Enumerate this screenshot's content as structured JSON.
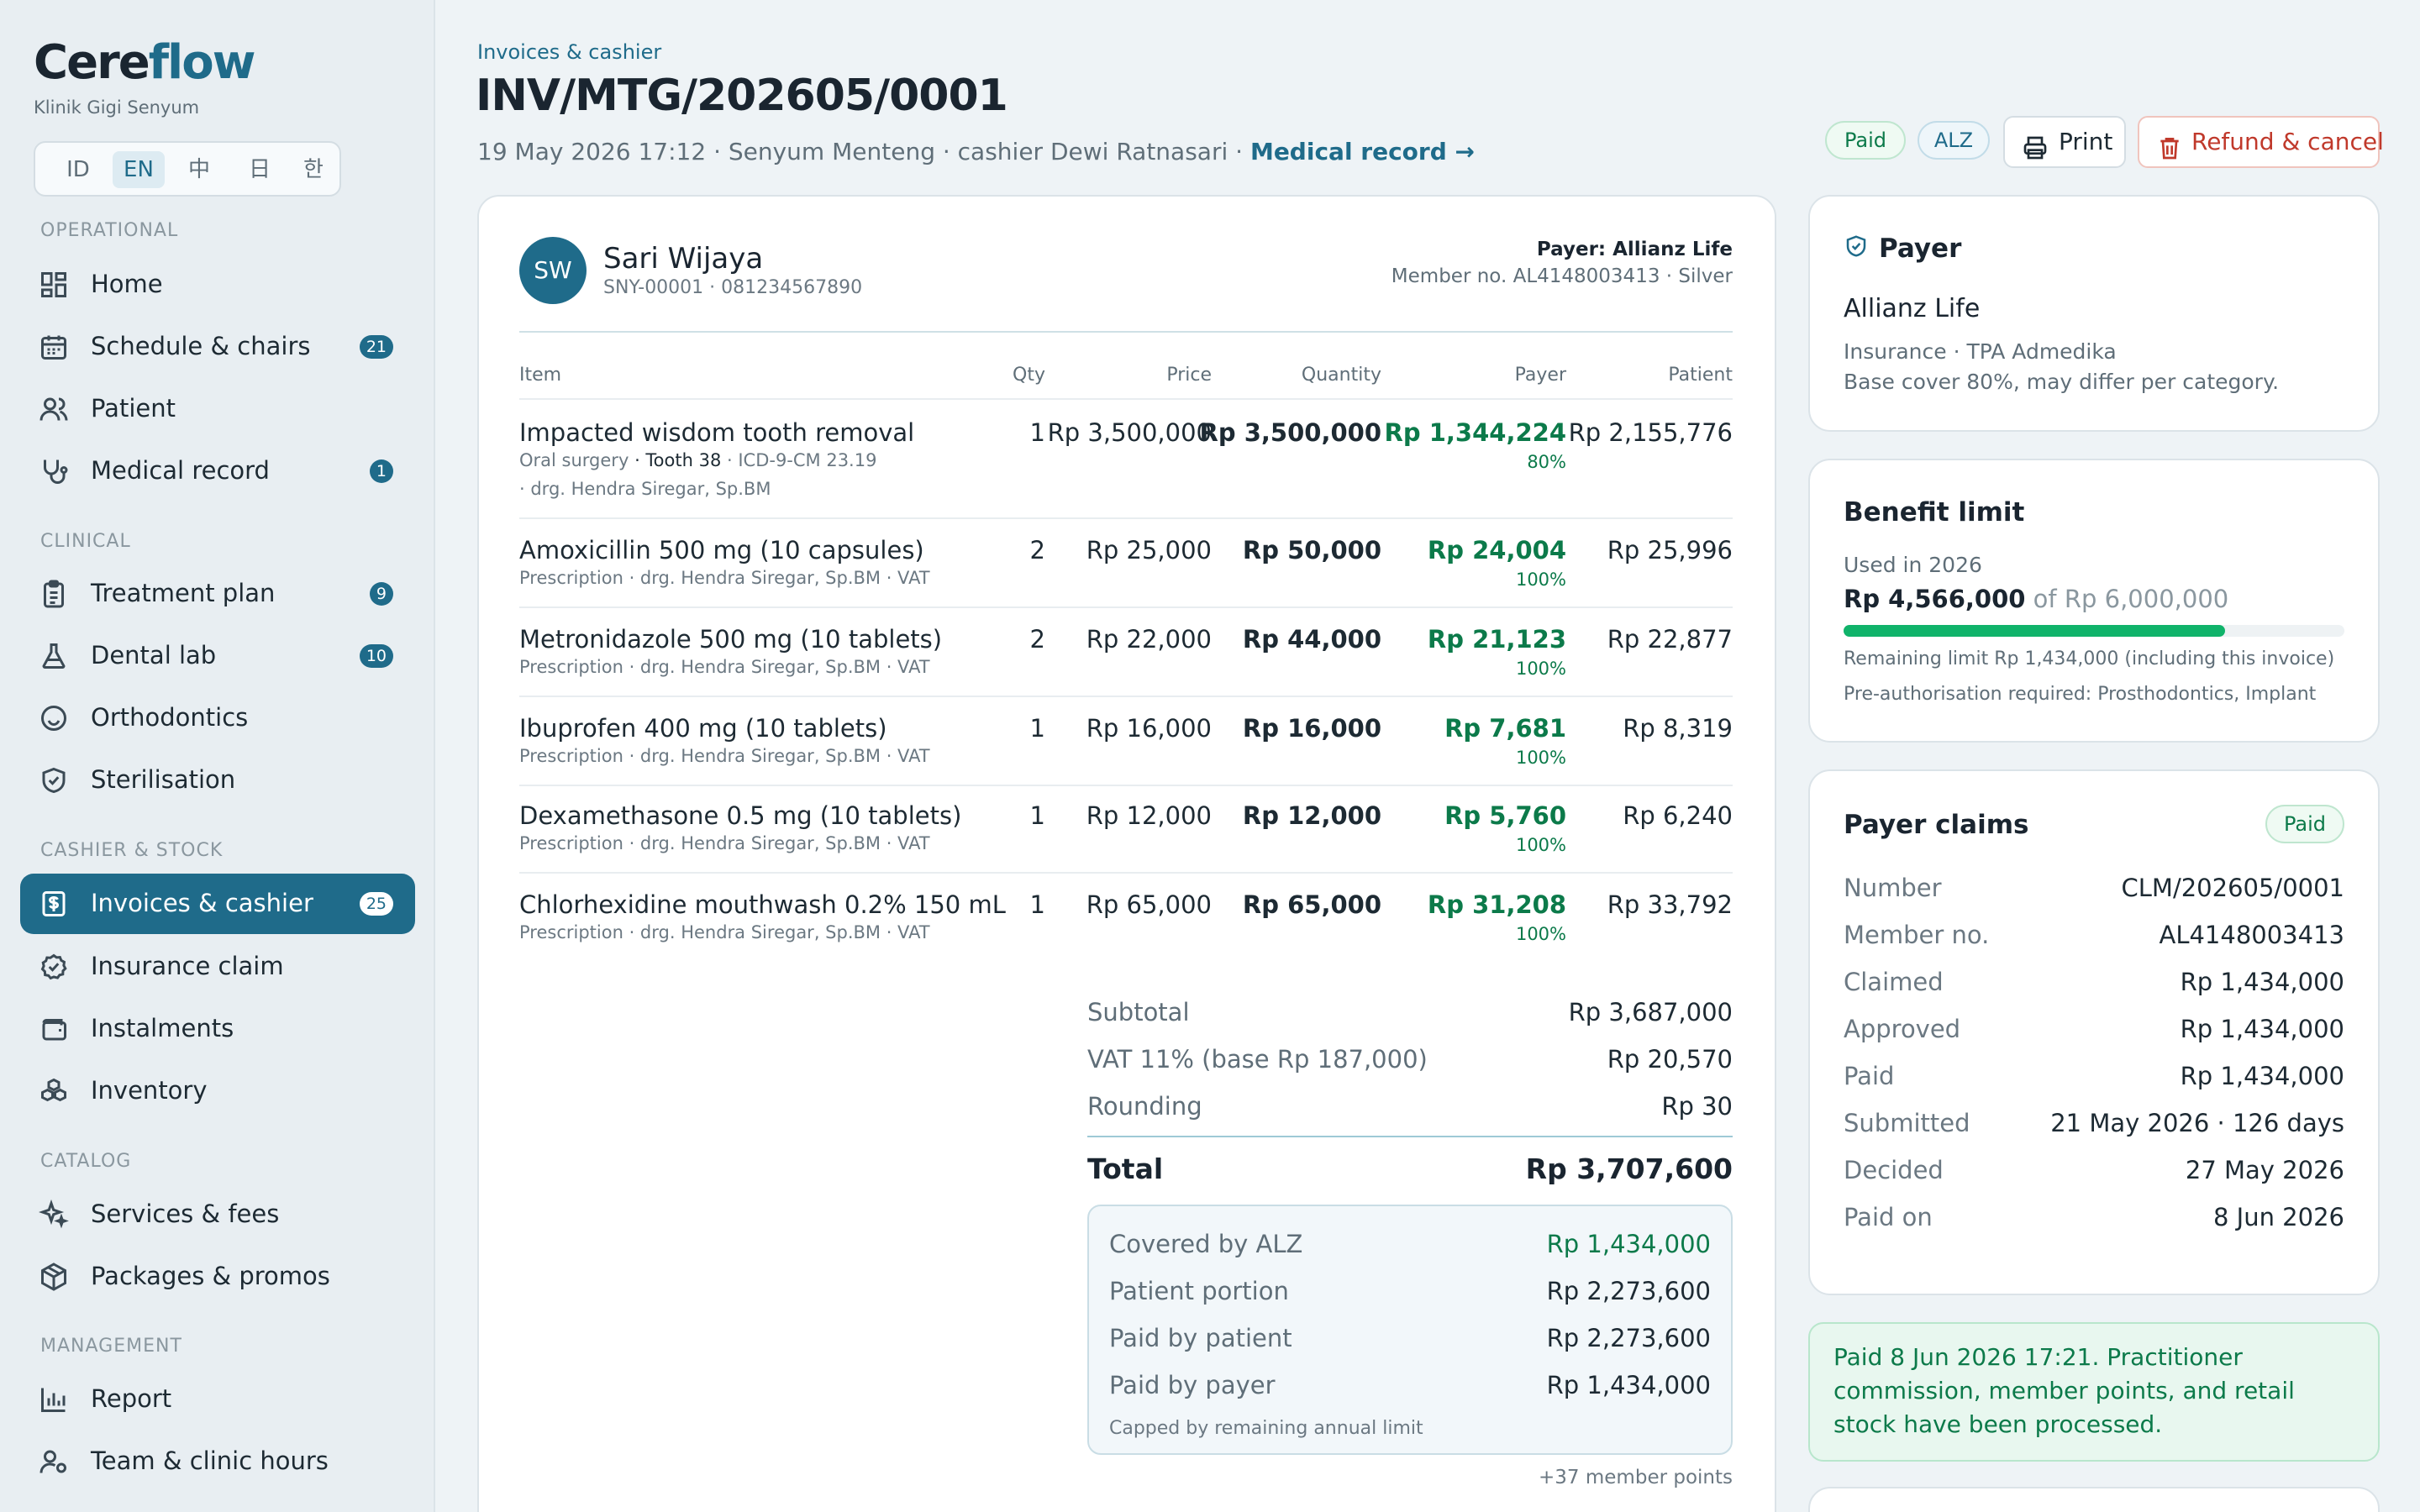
{
  "app": {
    "brand_part1": "Cere",
    "brand_part2": "flow",
    "clinic": "Klinik Gigi Senyum"
  },
  "languages": [
    "ID",
    "EN",
    "中",
    "日",
    "한"
  ],
  "active_language": "EN",
  "nav_sections": {
    "operational": "OPERATIONAL",
    "clinical": "CLINICAL",
    "cashier_stock": "CASHIER & STOCK",
    "catalog": "CATALOG",
    "management": "MANAGEMENT"
  },
  "nav": {
    "home": {
      "label": "Home"
    },
    "schedule": {
      "label": "Schedule & chairs",
      "count": "21"
    },
    "patient": {
      "label": "Patient"
    },
    "medical_record": {
      "label": "Medical record",
      "count": "1"
    },
    "treatment_plan": {
      "label": "Treatment plan",
      "count": "9"
    },
    "dental_lab": {
      "label": "Dental lab",
      "count": "10"
    },
    "orthodontics": {
      "label": "Orthodontics"
    },
    "sterilisation": {
      "label": "Sterilisation"
    },
    "invoices": {
      "label": "Invoices & cashier",
      "count": "25"
    },
    "insurance_claim": {
      "label": "Insurance claim"
    },
    "instalments": {
      "label": "Instalments"
    },
    "inventory": {
      "label": "Inventory"
    },
    "services_fees": {
      "label": "Services & fees"
    },
    "packages": {
      "label": "Packages & promos"
    },
    "report": {
      "label": "Report"
    },
    "team": {
      "label": "Team & clinic hours"
    }
  },
  "header": {
    "breadcrumb": "Invoices & cashier",
    "title": "INV/MTG/202605/0001",
    "meta": "19 May 2026 17:12 · Senyum Menteng · cashier Dewi Ratnasari · ",
    "medical_record_link": "Medical record →",
    "status_pill": "Paid",
    "payer_pill": "ALZ",
    "print_label": "Print",
    "refund_label": "Refund & cancel"
  },
  "patient": {
    "initials": "SW",
    "name": "Sari Wijaya",
    "id_phone": "SNY-00001 · 081234567890",
    "payer_label": "Payer: Allianz Life",
    "member_info": "Member no. AL4148003413 · Silver"
  },
  "table": {
    "headers": {
      "item": "Item",
      "qty": "Qty",
      "price": "Price",
      "quantity": "Quantity",
      "payer": "Payer",
      "patient": "Patient"
    },
    "rows": [
      {
        "name": "Impacted wisdom tooth removal",
        "sub1": "Oral surgery",
        "tooth": "· Tooth 38",
        "sub2": " · ICD-9-CM 23.19",
        "sub3": "· drg. Hendra Siregar, Sp.BM",
        "qty": "1",
        "price": "Rp 3,500,000",
        "amount": "Rp 3,500,000",
        "payer": "Rp 1,344,224",
        "pct": "80%",
        "patient": "Rp 2,155,776"
      },
      {
        "name": "Amoxicillin 500 mg (10 capsules)",
        "sub": "Prescription  · drg. Hendra Siregar, Sp.BM  · VAT",
        "qty": "2",
        "price": "Rp 25,000",
        "amount": "Rp 50,000",
        "payer": "Rp 24,004",
        "pct": "100%",
        "patient": "Rp 25,996"
      },
      {
        "name": "Metronidazole 500 mg (10 tablets)",
        "sub": "Prescription  · drg. Hendra Siregar, Sp.BM  · VAT",
        "qty": "2",
        "price": "Rp 22,000",
        "amount": "Rp 44,000",
        "payer": "Rp 21,123",
        "pct": "100%",
        "patient": "Rp 22,877"
      },
      {
        "name": "Ibuprofen 400 mg (10 tablets)",
        "sub": "Prescription  · drg. Hendra Siregar, Sp.BM  · VAT",
        "qty": "1",
        "price": "Rp 16,000",
        "amount": "Rp 16,000",
        "payer": "Rp 7,681",
        "pct": "100%",
        "patient": "Rp 8,319"
      },
      {
        "name": "Dexamethasone 0.5 mg (10 tablets)",
        "sub": "Prescription  · drg. Hendra Siregar, Sp.BM  · VAT",
        "qty": "1",
        "price": "Rp 12,000",
        "amount": "Rp 12,000",
        "payer": "Rp 5,760",
        "pct": "100%",
        "patient": "Rp 6,240"
      },
      {
        "name": "Chlorhexidine mouthwash 0.2% 150 mL",
        "sub": "Prescription  · drg. Hendra Siregar, Sp.BM  · VAT",
        "qty": "1",
        "price": "Rp 65,000",
        "amount": "Rp 65,000",
        "payer": "Rp 31,208",
        "pct": "100%",
        "patient": "Rp 33,792"
      }
    ]
  },
  "totals": {
    "subtotal_label": "Subtotal",
    "subtotal": "Rp 3,687,000",
    "vat_label": "VAT 11% (base Rp 187,000)",
    "vat": "Rp 20,570",
    "rounding_label": "Rounding",
    "rounding": "Rp 30",
    "total_label": "Total",
    "total": "Rp 3,707,600"
  },
  "coverage": {
    "covered_label": "Covered by ALZ",
    "covered": "Rp 1,434,000",
    "portion_label": "Patient portion",
    "portion": "Rp 2,273,600",
    "paid_patient_label": "Paid by patient",
    "paid_patient": "Rp 2,273,600",
    "paid_payer_label": "Paid by payer",
    "paid_payer": "Rp 1,434,000",
    "note": "Capped by remaining annual limit",
    "points": "+37 member points"
  },
  "payer_card": {
    "title": "Payer",
    "name": "Allianz Life",
    "type": "Insurance · TPA Admedika",
    "cover": "Base cover 80%, may differ per category."
  },
  "benefit": {
    "title": "Benefit limit",
    "used_label": "Used in 2026",
    "used": "Rp 4,566,000",
    "of": " of Rp 6,000,000",
    "fraction": 0.761,
    "remaining": "Remaining limit Rp 1,434,000 (including this invoice)",
    "preauth": "Pre-authorisation required: Prosthodontics, Implant"
  },
  "claims": {
    "title": "Payer claims",
    "status": "Paid",
    "rows": [
      {
        "label": "Number",
        "value": "CLM/202605/0001"
      },
      {
        "label": "Member no.",
        "value": "AL4148003413"
      },
      {
        "label": "Claimed",
        "value": "Rp 1,434,000"
      },
      {
        "label": "Approved",
        "value": "Rp 1,434,000"
      },
      {
        "label": "Paid",
        "value": "Rp 1,434,000"
      },
      {
        "label": "Submitted",
        "value": "21 May 2026 · 126 days"
      },
      {
        "label": "Decided",
        "value": "27 May 2026"
      },
      {
        "label": "Paid on",
        "value": "8 Jun 2026"
      }
    ]
  },
  "notice": "Paid 8 Jun 2026 17:21. Practitioner commission, member points, and retail stock have been processed.",
  "colors": {
    "accent": "#1f6b8a",
    "success": "#0c7a4a",
    "danger": "#c0392b",
    "success_bg": "#e8f7ef"
  }
}
